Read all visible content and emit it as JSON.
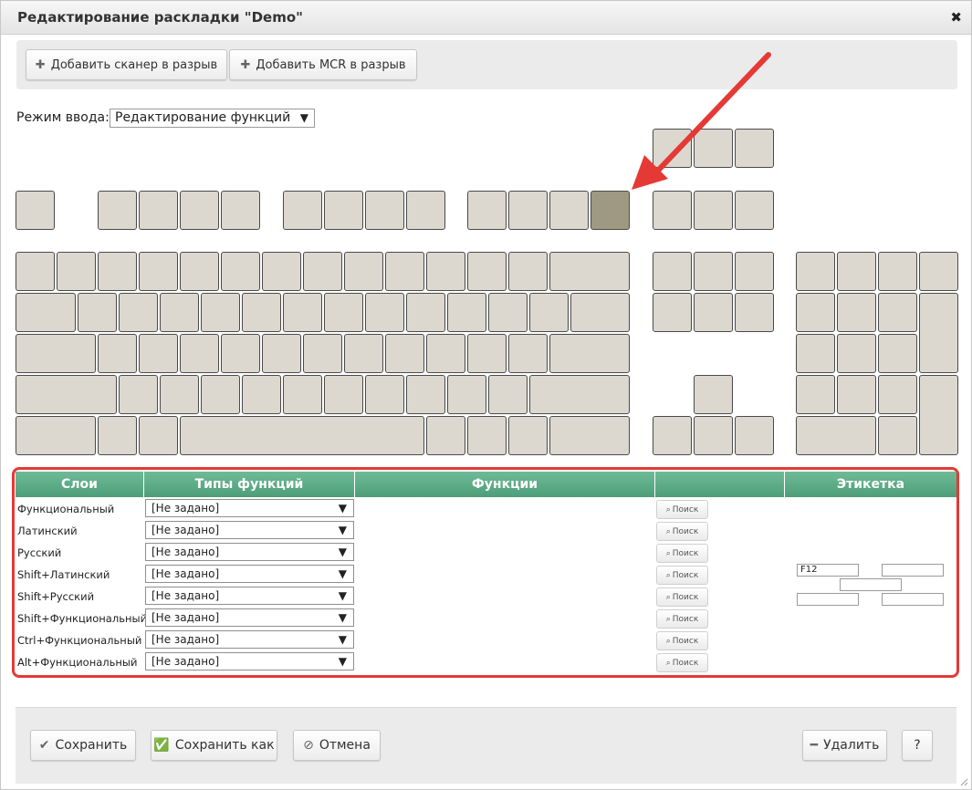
{
  "window": {
    "title": "Редактирование раскладки \"Demo\"",
    "close_symbol": "✖"
  },
  "toolbar": {
    "add_scanner": "Добавить сканер в разрыв",
    "add_mcr": "Добавить MCR в разрыв"
  },
  "mode": {
    "label": "Режим ввода:",
    "value": "Редактирование функций"
  },
  "keyboard": {
    "selected_key": "F12",
    "key_color": "#dcd8cf",
    "selected_color": "#9e9983"
  },
  "table": {
    "headers": {
      "layers": "Слои",
      "types": "Типы функций",
      "functions": "Функции",
      "empty": "",
      "label": "Этикетка"
    },
    "search_label": "Поиск",
    "rows": [
      {
        "layer": "Функциональный",
        "type": "[Не задано]"
      },
      {
        "layer": "Латинский",
        "type": "[Не задано]"
      },
      {
        "layer": "Русский",
        "type": "[Не задано]"
      },
      {
        "layer": "Shift+Латинский",
        "type": "[Не задано]"
      },
      {
        "layer": "Shift+Русский",
        "type": "[Не задано]"
      },
      {
        "layer": "Shift+Функциональный",
        "type": "[Не задано]"
      },
      {
        "layer": "Ctrl+Функциональный",
        "type": "[Не задано]"
      },
      {
        "layer": "Alt+Функциональный",
        "type": "[Не задано]"
      }
    ],
    "label_fields": {
      "top_left": "F12",
      "top_right": "",
      "middle": "",
      "bottom_left": "",
      "bottom_right": ""
    }
  },
  "footer": {
    "save": "Сохранить",
    "save_as": "Сохранить как",
    "cancel": "Отмена",
    "delete": "Удалить",
    "help": "?"
  },
  "colors": {
    "header_green": "#5aaa85",
    "highlight_red": "#e53935",
    "arrow_red": "#e53935"
  }
}
